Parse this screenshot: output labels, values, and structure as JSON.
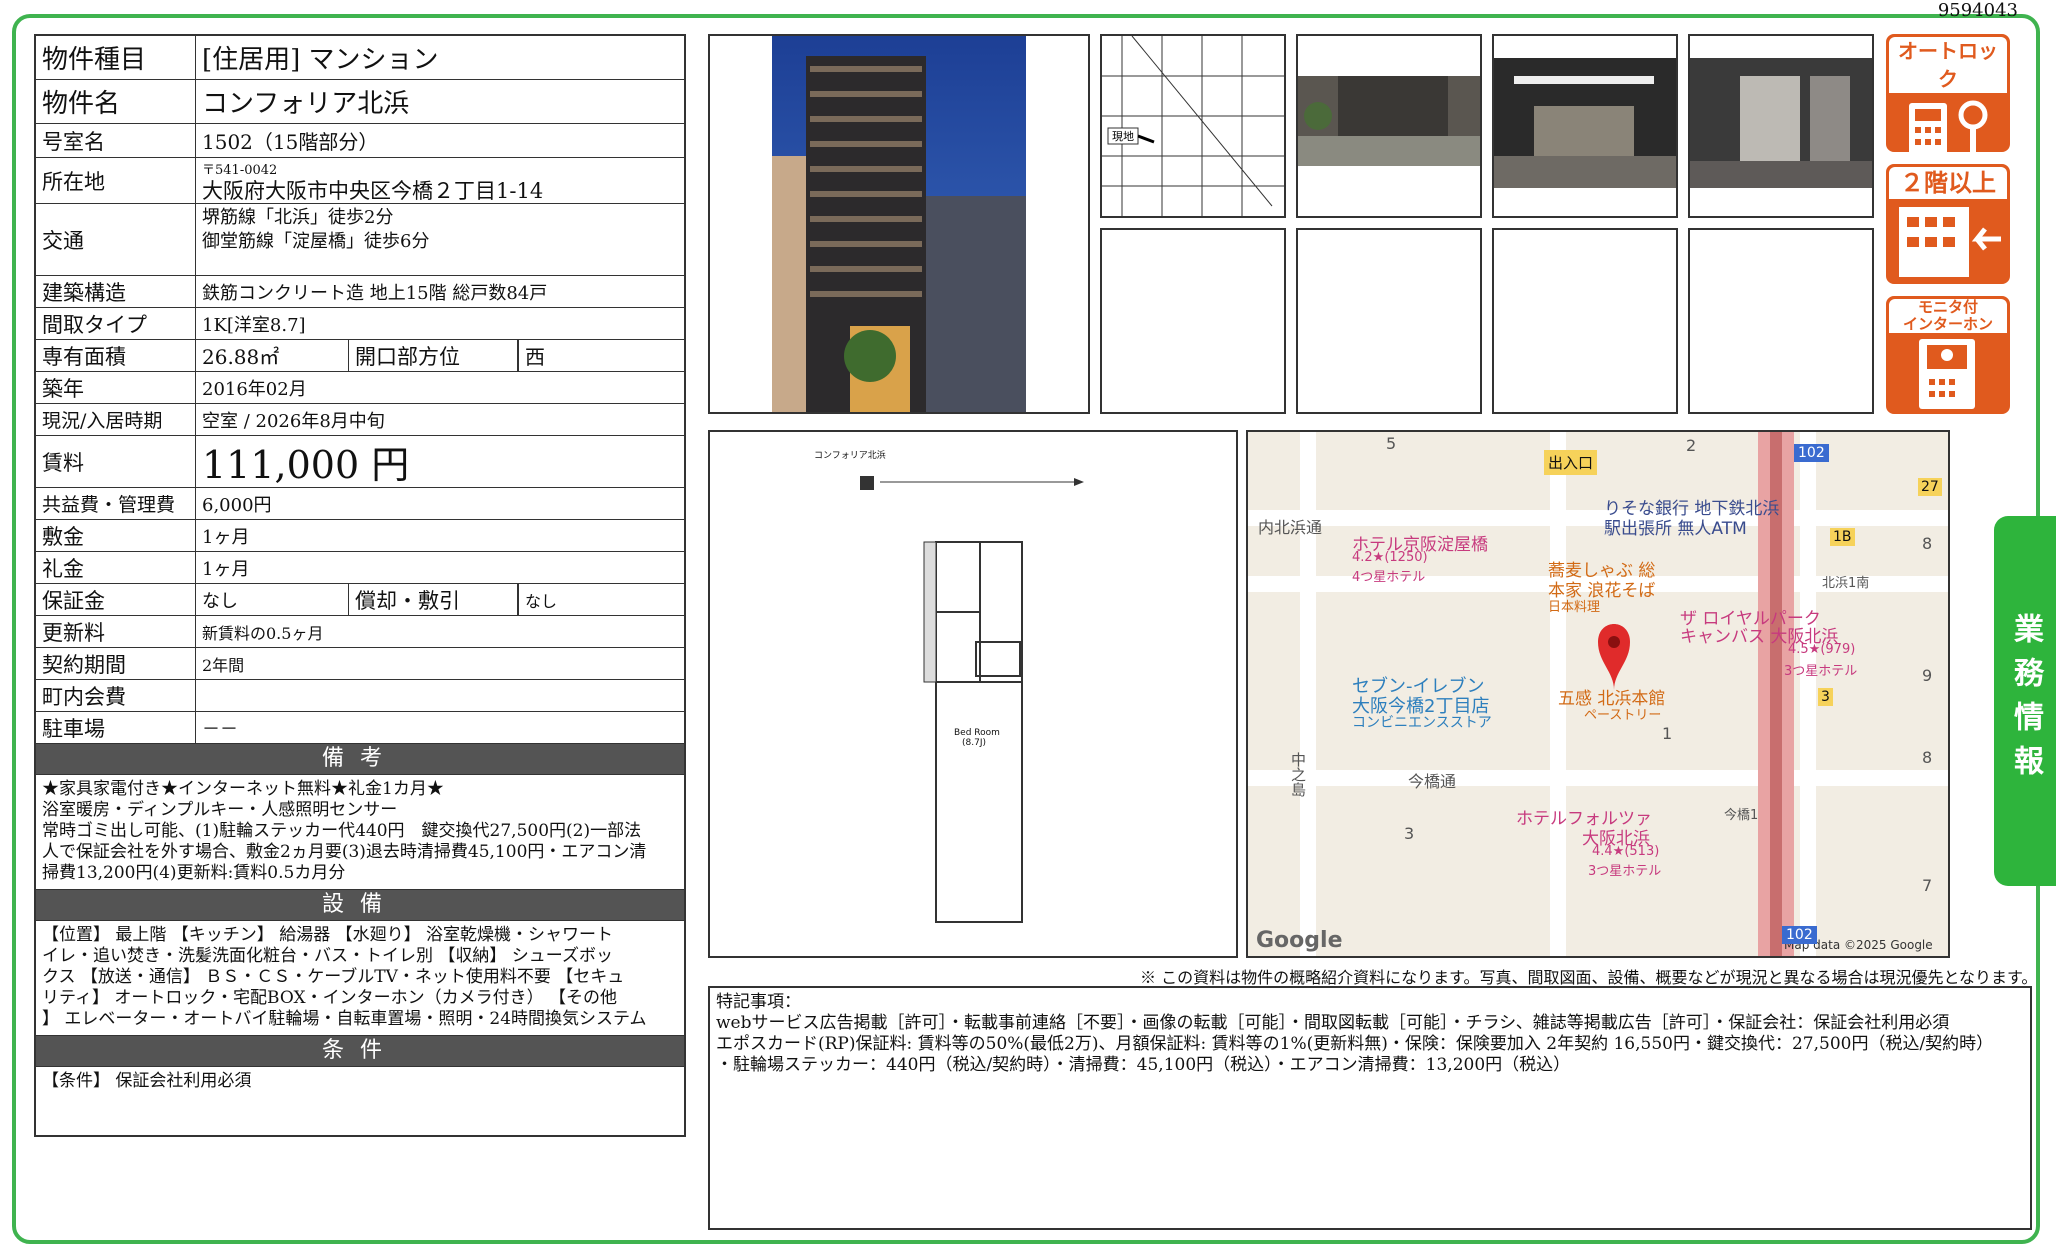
{
  "property_id": "9594043",
  "fields": {
    "type_label": "物件種目",
    "type_value": "[住居用] マンション",
    "name_label": "物件名",
    "name_value": "コンフォリア北浜",
    "room_label": "号室名",
    "room_value": "1502（15階部分）",
    "address_label": "所在地",
    "postal": "〒541-0042",
    "address_value": "大阪府大阪市中央区今橋２丁目1-14",
    "transit_label": "交通",
    "transit_1": "堺筋線「北浜」徒歩2分",
    "transit_2": "御堂筋線「淀屋橋」徒歩6分",
    "structure_label": "建築構造",
    "structure_value": "鉄筋コンクリート造 地上15階 総戸数84戸",
    "layout_label": "間取タイプ",
    "layout_value": "1K[洋室8.7]",
    "area_label": "専有面積",
    "area_value": "26.88㎡",
    "direction_label": "開口部方位",
    "direction_value": "西",
    "built_label": "築年",
    "built_value": "2016年02月",
    "status_label": "現況/入居時期",
    "status_value": "空室 / 2026年8月中旬",
    "rent_label": "賃料",
    "rent_value": "111,000 円",
    "fee_label": "共益費・管理費",
    "fee_value": "6,000円",
    "deposit_label": "敷金",
    "deposit_value": "1ヶ月",
    "keymoney_label": "礼金",
    "keymoney_value": "1ヶ月",
    "guarantee_label": "保証金",
    "guarantee_value": "なし",
    "amort_label": "償却・敷引",
    "amort_value": "なし",
    "renewal_label": "更新料",
    "renewal_value": "新賃料の0.5ヶ月",
    "term_label": "契約期間",
    "term_value": "2年間",
    "town_label": "町内会費",
    "town_value": "",
    "parking_label": "駐車場",
    "parking_value": "－－"
  },
  "remarks": {
    "heading": "備考",
    "lines": [
      "★家具家電付き★インターネット無料★礼金1カ月★",
      "浴室暖房・ディンプルキー・人感照明センサー",
      "常時ゴミ出し可能、(1)駐輪ステッカー代440円　鍵交換代27,500円(2)一部法",
      "人で保証会社を外す場合、敷金2ヵ月要(3)退去時清掃費45,100円・エアコン清",
      "掃費13,200円(4)更新料:賃料0.5カ月分"
    ]
  },
  "equipment": {
    "heading": "設備",
    "lines": [
      "【位置】 最上階 【キッチン】 給湯器 【水廻り】 浴室乾燥機・シャワート",
      "イレ・追い焚き・洗髪洗面化粧台・バス・トイレ別 【収納】 シューズボッ",
      "クス 【放送・通信】 ＢＳ・ＣＳ・ケーブルTV・ネット使用料不要 【セキュ",
      "リティ】 オートロック・宅配BOX・インターホン（カメラ付き） 【その他",
      "】 エレベーター・オートバイ駐輪場・自転車置場・照明・24時間換気システム"
    ]
  },
  "conditions": {
    "heading": "条件",
    "text": "【条件】 保証会社利用必須"
  },
  "icons": [
    {
      "name": "autolock-icon",
      "label": "オートロック"
    },
    {
      "name": "second-floor-icon",
      "label": "２階以上"
    },
    {
      "name": "monitor-intercom-icon",
      "label": "モニタ付\nインターホン"
    }
  ],
  "floorplan": {
    "title": "コンフォリア北浜",
    "room_label": "Bed Room",
    "room_size": "(8.7J)"
  },
  "minimap_label": "現地",
  "map": {
    "labels": [
      "出入口",
      "りそな銀行 地下鉄北浜",
      "駅出張所 無人ATM",
      "内北浜通",
      "ホテル京阪淀屋橋",
      "4.2★(1250)",
      "4つ星ホテル",
      "蕎麦しゃぶ 総",
      "本家 浪花そば",
      "日本料理",
      "北浜1南",
      "ザ ロイヤルパーク",
      "キャンバス 大阪北浜",
      "4.5★(979)",
      "3つ星ホテル",
      "セブン-イレブン",
      "大阪今橋2丁目店",
      "コンビニエンスストア",
      "五感 北浜本館",
      "ペーストリー",
      "中之島",
      "今橋通",
      "今橋1",
      "ホテルフォルツァ",
      "大阪北浜",
      "4.4★(513)",
      "3つ星ホテル",
      "Map data ©2025 Google",
      "Google"
    ],
    "numbers": [
      "5",
      "2",
      "102",
      "27",
      "8",
      "1B",
      "9",
      "3",
      "1",
      "8",
      "3",
      "7",
      "102"
    ]
  },
  "disclaimer": "※ この資料は物件の概略紹介資料になります。写真、間取図面、設備、概要などが現況と異なる場合は現況優先となります。",
  "special_notes": {
    "heading": "特記事項：",
    "lines": [
      "webサービス広告掲載［許可］・転載事前連絡［不要］・画像の転載［可能］・間取図転載［可能］・チラシ、雑誌等掲載広告［許可］・保証会社：保証会社利用必須",
      "エポスカード(RP)保証料: 賃料等の50%(最低2万)、月額保証料: 賃料等の1%(更新料無)・保険：保険要加入 2年契約 16,550円・鍵交換代：27,500円（税込/契約時）",
      "・駐輪場ステッカー：440円（税込/契約時）・清掃費：45,100円（税込）・エアコン清掃費：13,200円（税込）"
    ]
  },
  "side_tab": "業務情報"
}
